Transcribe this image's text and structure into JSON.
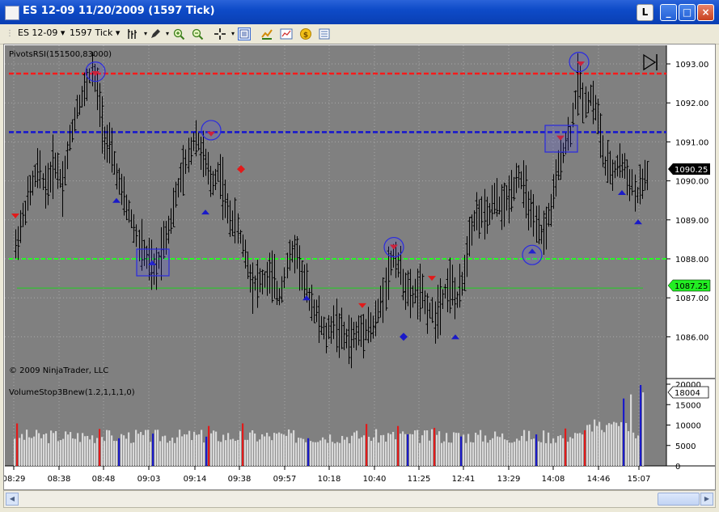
{
  "window": {
    "title": "ES 12-09  11/20/2009 (1597 Tick)",
    "l_button": "L",
    "min_glyph": "_",
    "max_glyph": "□",
    "close_glyph": "×"
  },
  "toolbar": {
    "instrument": "ES 12-09",
    "interval": "1597 Tick",
    "dropdown_glyph": "▾"
  },
  "chart": {
    "indicator_top": "PivotsRSI(151500,83000)",
    "copyright": "© 2009 NinjaTrader, LLC",
    "indicator_bottom": "VolumeStop3Bnew(1.2,1,1,1,0)",
    "last_price_label": "1090.25",
    "green_line_label": "1087.25",
    "volume_label": "18004",
    "price_ticks": [
      "1093.00",
      "1092.00",
      "1091.00",
      "1090.00",
      "1089.00",
      "1088.00",
      "1087.00",
      "1086.00"
    ],
    "volume_ticks": [
      "20000",
      "15000",
      "10000",
      "5000",
      "0"
    ],
    "time_labels": [
      "08:29",
      "08:38",
      "08:48",
      "09:03",
      "09:14",
      "09:38",
      "09:57",
      "10:18",
      "10:40",
      "11:25",
      "12:41",
      "13:29",
      "14:08",
      "14:46",
      "15:07"
    ],
    "colors": {
      "background": "#808080",
      "bar": "#000000",
      "red_line": "#FF1A1A",
      "blue_line": "#1515D0",
      "green_line": "#22FF22",
      "marker_red": "#E21A1A",
      "marker_blue": "#1A1AC8",
      "volume_gray": "#D8D8D8"
    }
  }
}
